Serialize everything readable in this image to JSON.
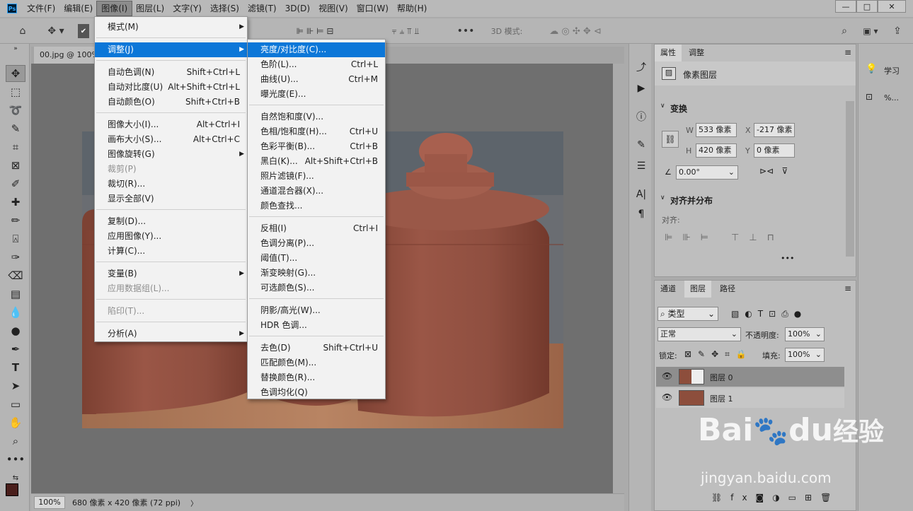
{
  "menubar": {
    "items": [
      "文件(F)",
      "编辑(E)",
      "图像(I)",
      "图层(L)",
      "文字(Y)",
      "选择(S)",
      "滤镜(T)",
      "3D(D)",
      "视图(V)",
      "窗口(W)",
      "帮助(H)"
    ],
    "active_index": 2
  },
  "window": {
    "minimize": "—",
    "maximize": "□",
    "close": "✕"
  },
  "options": {
    "mode3d": "3D 模式:"
  },
  "document": {
    "tab": "00.jpg @ 100%",
    "zoom": "100%",
    "info": "680 像素 x 420 像素 (72 ppi)",
    "arrow": "〉"
  },
  "image_menu": [
    {
      "label": "模式(M)",
      "sub": true
    },
    {
      "sep": true
    },
    {
      "label": "调整(J)",
      "sub": true,
      "hl": true
    },
    {
      "sep": true
    },
    {
      "label": "自动色调(N)",
      "sc": "Shift+Ctrl+L"
    },
    {
      "label": "自动对比度(U)",
      "sc": "Alt+Shift+Ctrl+L"
    },
    {
      "label": "自动颜色(O)",
      "sc": "Shift+Ctrl+B"
    },
    {
      "sep": true
    },
    {
      "label": "图像大小(I)...",
      "sc": "Alt+Ctrl+I"
    },
    {
      "label": "画布大小(S)...",
      "sc": "Alt+Ctrl+C"
    },
    {
      "label": "图像旋转(G)",
      "sub": true
    },
    {
      "label": "裁剪(P)",
      "dis": true
    },
    {
      "label": "裁切(R)..."
    },
    {
      "label": "显示全部(V)"
    },
    {
      "sep": true
    },
    {
      "label": "复制(D)..."
    },
    {
      "label": "应用图像(Y)..."
    },
    {
      "label": "计算(C)..."
    },
    {
      "sep": true
    },
    {
      "label": "变量(B)",
      "sub": true
    },
    {
      "label": "应用数据组(L)...",
      "dis": true
    },
    {
      "sep": true
    },
    {
      "label": "陷印(T)...",
      "dis": true
    },
    {
      "sep": true
    },
    {
      "label": "分析(A)",
      "sub": true
    }
  ],
  "adjust_menu": [
    {
      "label": "亮度/对比度(C)...",
      "hl": true
    },
    {
      "label": "色阶(L)...",
      "sc": "Ctrl+L"
    },
    {
      "label": "曲线(U)...",
      "sc": "Ctrl+M"
    },
    {
      "label": "曝光度(E)..."
    },
    {
      "sep": true
    },
    {
      "label": "自然饱和度(V)..."
    },
    {
      "label": "色相/饱和度(H)...",
      "sc": "Ctrl+U"
    },
    {
      "label": "色彩平衡(B)...",
      "sc": "Ctrl+B"
    },
    {
      "label": "黑白(K)...",
      "sc": "Alt+Shift+Ctrl+B"
    },
    {
      "label": "照片滤镜(F)..."
    },
    {
      "label": "通道混合器(X)..."
    },
    {
      "label": "颜色查找..."
    },
    {
      "sep": true
    },
    {
      "label": "反相(I)",
      "sc": "Ctrl+I"
    },
    {
      "label": "色调分离(P)..."
    },
    {
      "label": "阈值(T)..."
    },
    {
      "label": "渐变映射(G)..."
    },
    {
      "label": "可选颜色(S)..."
    },
    {
      "sep": true
    },
    {
      "label": "阴影/高光(W)..."
    },
    {
      "label": "HDR 色调..."
    },
    {
      "sep": true
    },
    {
      "label": "去色(D)",
      "sc": "Shift+Ctrl+U"
    },
    {
      "label": "匹配颜色(M)..."
    },
    {
      "label": "替换颜色(R)..."
    },
    {
      "label": "色调均化(Q)"
    }
  ],
  "properties": {
    "tab1": "属性",
    "tab2": "调整",
    "layer_type": "像素图层",
    "transform": "变换",
    "w_label": "W",
    "w": "533 像素",
    "x_label": "X",
    "x": "-217 像素",
    "h_label": "H",
    "h": "420 像素",
    "y_label": "Y",
    "y": "0 像素",
    "angle": "0.00°",
    "align_title": "对齐并分布",
    "align_label": "对齐:",
    "more": "•••"
  },
  "layers": {
    "tab1": "通道",
    "tab2": "图层",
    "tab3": "路径",
    "filter": "类型",
    "blend": "正常",
    "opacity_label": "不透明度:",
    "opacity": "100%",
    "lock_label": "锁定:",
    "fill_label": "填充:",
    "fill": "100%",
    "items": [
      "图层 0",
      "图层 1"
    ]
  },
  "right": {
    "learn": "学习",
    "pct": "%..."
  },
  "watermark": {
    "brand_a": "Bai",
    "brand_b": "du",
    "brand_cn": "经验",
    "url": "jingyan.baidu.com"
  }
}
